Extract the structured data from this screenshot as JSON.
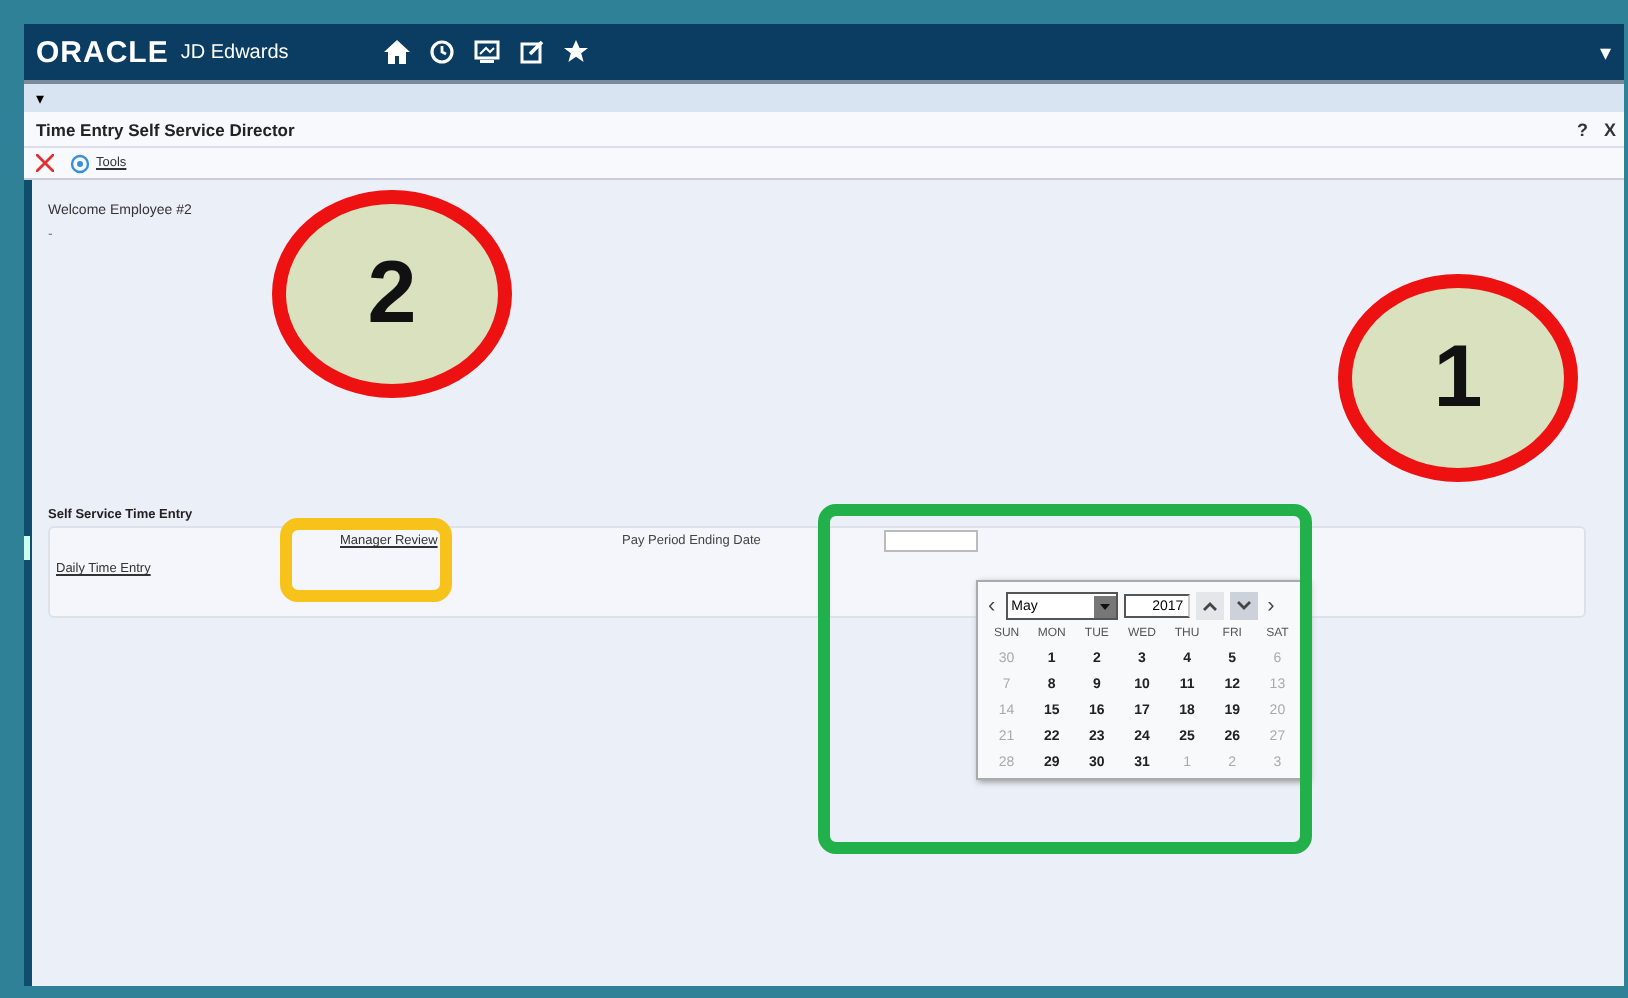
{
  "header": {
    "logo": "ORACLE",
    "product": "JD Edwards",
    "menu_glyph": "▾"
  },
  "breadcrumb": {
    "glyph": "▾"
  },
  "form": {
    "title": "Time Entry Self Service Director",
    "help": "?",
    "close": "X"
  },
  "toolbar": {
    "tools": "Tools"
  },
  "welcome": "Welcome Employee #2",
  "dash": "-",
  "section": {
    "title": "Self Service Time Entry",
    "links": [
      {
        "label": "Manager Review"
      },
      {
        "label": "Daily Time Entry"
      }
    ],
    "date_label": "Pay Period Ending Date"
  },
  "calendar": {
    "month": "May",
    "year": "2017",
    "prev": "‹",
    "next": "›",
    "weekdays": [
      "SUN",
      "MON",
      "TUE",
      "WED",
      "THU",
      "FRI",
      "SAT"
    ],
    "weeks": [
      [
        {
          "label": "30",
          "muted": true
        },
        {
          "label": "1",
          "muted": false
        },
        {
          "label": "2",
          "muted": false
        },
        {
          "label": "3",
          "muted": false
        },
        {
          "label": "4",
          "muted": false
        },
        {
          "label": "5",
          "muted": false
        },
        {
          "label": "6",
          "muted": true
        }
      ],
      [
        {
          "label": "7",
          "muted": true
        },
        {
          "label": "8",
          "muted": false
        },
        {
          "label": "9",
          "muted": false
        },
        {
          "label": "10",
          "muted": false
        },
        {
          "label": "11",
          "muted": false
        },
        {
          "label": "12",
          "muted": false
        },
        {
          "label": "13",
          "muted": true
        }
      ],
      [
        {
          "label": "14",
          "muted": true
        },
        {
          "label": "15",
          "muted": false
        },
        {
          "label": "16",
          "muted": false
        },
        {
          "label": "17",
          "muted": false
        },
        {
          "label": "18",
          "muted": false
        },
        {
          "label": "19",
          "muted": false
        },
        {
          "label": "20",
          "muted": true
        }
      ],
      [
        {
          "label": "21",
          "muted": true
        },
        {
          "label": "22",
          "muted": false
        },
        {
          "label": "23",
          "muted": false
        },
        {
          "label": "24",
          "muted": false
        },
        {
          "label": "25",
          "muted": false
        },
        {
          "label": "26",
          "muted": false
        },
        {
          "label": "27",
          "muted": true
        }
      ],
      [
        {
          "label": "28",
          "muted": true
        },
        {
          "label": "29",
          "muted": false
        },
        {
          "label": "30",
          "muted": false
        },
        {
          "label": "31",
          "muted": false
        },
        {
          "label": "1",
          "muted": true
        },
        {
          "label": "2",
          "muted": true
        },
        {
          "label": "3",
          "muted": true
        }
      ]
    ]
  },
  "annotations": [
    {
      "number": "2",
      "color": "#ee1111"
    },
    {
      "number": "1",
      "color": "#ee1111"
    }
  ],
  "highlights": [
    {
      "color": "#f7c21a"
    },
    {
      "color": "#22b04a"
    }
  ]
}
